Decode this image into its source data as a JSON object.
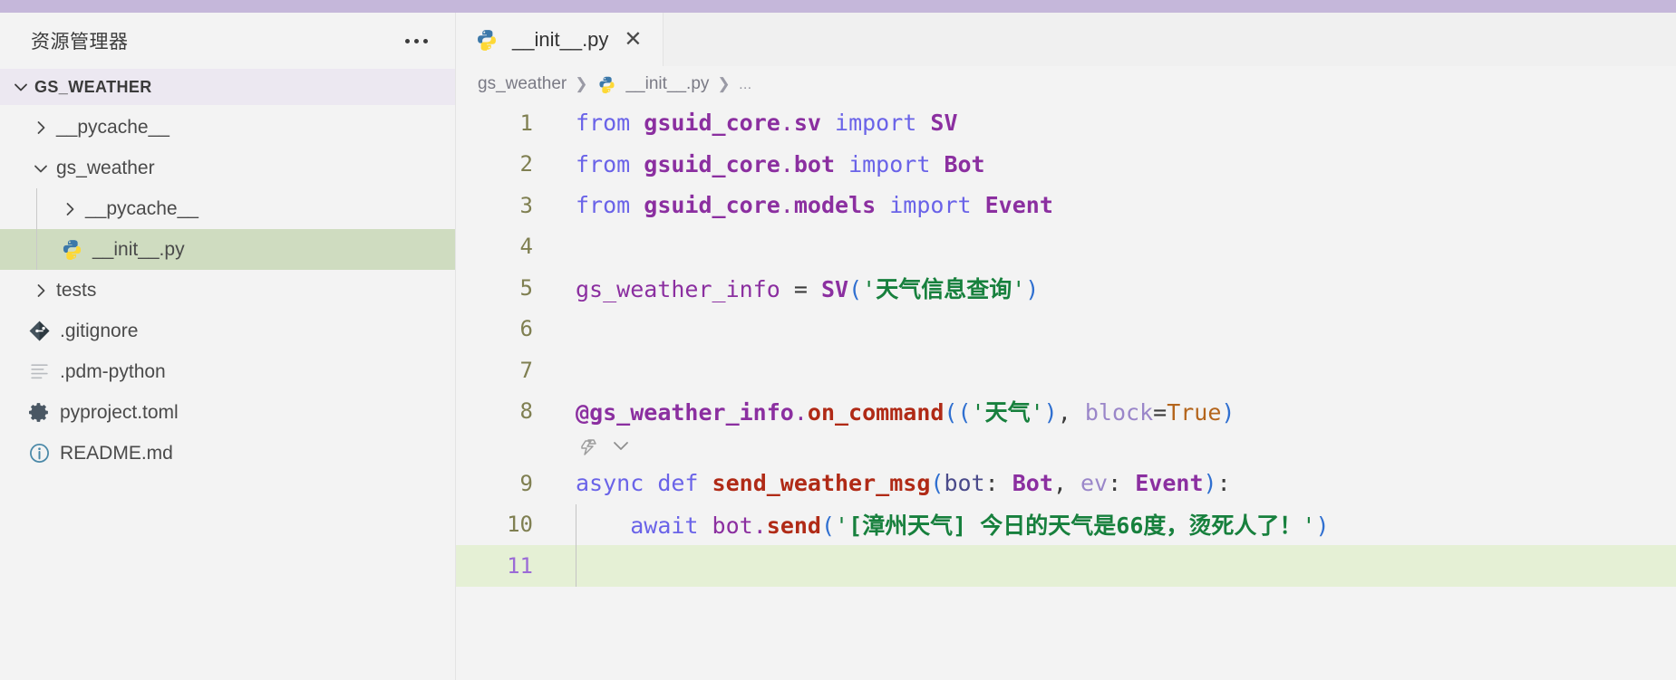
{
  "window": {
    "titlebar_color": "#c5b7da"
  },
  "sidebar": {
    "title": "资源管理器",
    "more_label": "···",
    "root": {
      "label": "GS_WEATHER",
      "expanded": true
    },
    "items": [
      {
        "label": "__pycache__",
        "type": "folder",
        "expanded": false,
        "depth": 1,
        "icon": "chevron-right-icon",
        "selected": false
      },
      {
        "label": "gs_weather",
        "type": "folder",
        "expanded": true,
        "depth": 1,
        "icon": "chevron-down-icon",
        "selected": false
      },
      {
        "label": "__pycache__",
        "type": "folder",
        "expanded": false,
        "depth": 2,
        "icon": "chevron-right-icon",
        "selected": false
      },
      {
        "label": "__init__.py",
        "type": "file",
        "depth": 2,
        "icon": "python-file-icon",
        "selected": true
      },
      {
        "label": "tests",
        "type": "folder",
        "expanded": false,
        "depth": 1,
        "icon": "chevron-right-icon",
        "selected": false
      },
      {
        "label": ".gitignore",
        "type": "file",
        "depth": 1,
        "icon": "git-file-icon",
        "selected": false
      },
      {
        "label": ".pdm-python",
        "type": "file",
        "depth": 1,
        "icon": "text-file-icon",
        "selected": false
      },
      {
        "label": "pyproject.toml",
        "type": "file",
        "depth": 1,
        "icon": "gear-file-icon",
        "selected": false
      },
      {
        "label": "README.md",
        "type": "file",
        "depth": 1,
        "icon": "info-file-icon",
        "selected": false
      }
    ]
  },
  "editor": {
    "tab": {
      "label": "__init__.py",
      "icon": "python-file-icon",
      "close_label": "✕"
    },
    "breadcrumb": {
      "items": [
        "gs_weather",
        "__init__.py"
      ],
      "separator": "❯",
      "overflow": "…"
    },
    "active_line": 11,
    "quick_action": {
      "icon": "quick-fix-icon",
      "chevron": "chevron-down-icon"
    },
    "lines": [
      {
        "n": 1,
        "text": "from gsuid_core.sv import SV"
      },
      {
        "n": 2,
        "text": "from gsuid_core.bot import Bot"
      },
      {
        "n": 3,
        "text": "from gsuid_core.models import Event"
      },
      {
        "n": 4,
        "text": ""
      },
      {
        "n": 5,
        "text": "gs_weather_info = SV('天气信息查询')"
      },
      {
        "n": 6,
        "text": ""
      },
      {
        "n": 7,
        "text": ""
      },
      {
        "n": 8,
        "text": "@gs_weather_info.on_command(('天气'), block=True)"
      },
      {
        "n": 9,
        "text": "async def send_weather_msg(bot: Bot, ev: Event):"
      },
      {
        "n": 10,
        "text": "    await bot.send('[漳州天气] 今日的天气是66度，烫死人了！')"
      },
      {
        "n": 11,
        "text": ""
      }
    ],
    "colors": {
      "keyword": "#6a63e8",
      "module": "#8b2fa0",
      "class": "#8b2fa0",
      "function": "#b02a16",
      "string": "#17803d",
      "paren": "#2f6fd0",
      "boolean": "#b4651c",
      "param": "#9a86c9",
      "gutter": "#7f7f51",
      "active_line_bg": "#e5f0d5",
      "active_gutter": "#9b6bd6",
      "selected_row_bg": "#cfdcc0",
      "root_row_bg": "#ece8f1"
    }
  }
}
